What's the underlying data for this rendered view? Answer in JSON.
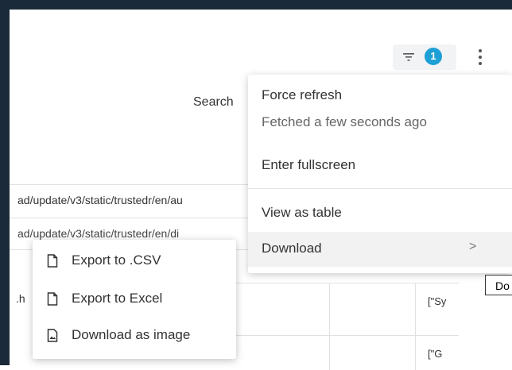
{
  "header": {
    "filter_count": "1",
    "search_label": "Search"
  },
  "table": {
    "row1_url": "ad/update/v3/static/trustedr/en/au",
    "row2_url": "ad/update/v3/static/trustedr/en/di",
    "row3_fragment": ".h",
    "col_right_1": "[\"Sy",
    "col_right_2": "[\"G"
  },
  "menu": {
    "force_refresh": "Force refresh",
    "fetched": "Fetched a few seconds ago",
    "enter_fullscreen": "Enter fullscreen",
    "view_as_table": "View as table",
    "download": "Download",
    "download_chevron": ">"
  },
  "tooltip": {
    "text": "Do"
  },
  "download_submenu": {
    "items": [
      {
        "label": "Export to .CSV",
        "icon": "file-icon"
      },
      {
        "label": "Export to Excel",
        "icon": "file-icon"
      },
      {
        "label": "Download as image",
        "icon": "image-file-icon"
      }
    ]
  },
  "colors": {
    "frame": "#1b2a3a",
    "badge": "#1e9fd6"
  }
}
